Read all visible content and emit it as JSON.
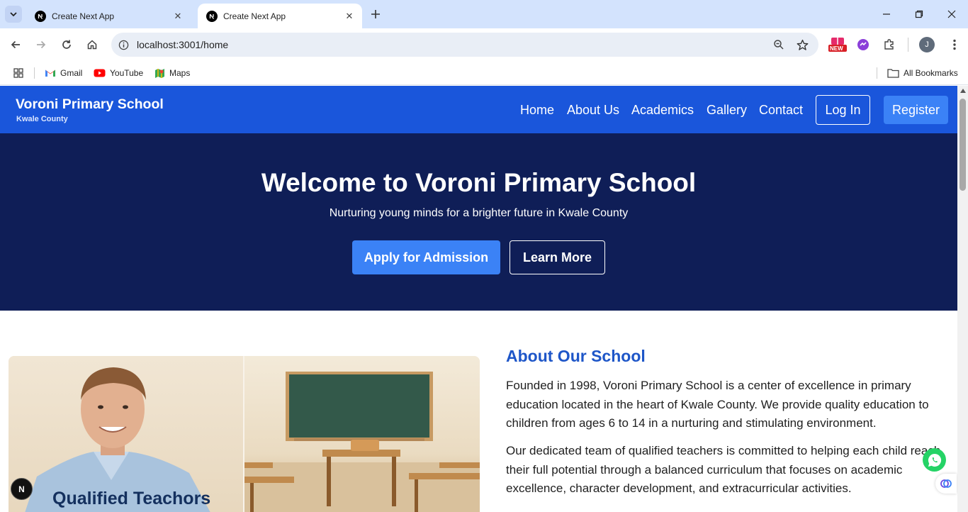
{
  "browser": {
    "tabs": [
      {
        "title": "Create Next App",
        "active": false
      },
      {
        "title": "Create Next App",
        "active": true
      }
    ],
    "url": "localhost:3001/home",
    "ext_badge": "NEW",
    "profile_initial": "J",
    "bookmarks": [
      "Gmail",
      "YouTube",
      "Maps"
    ],
    "all_bookmarks": "All Bookmarks"
  },
  "site": {
    "brand_title": "Voroni Primary School",
    "brand_subtitle": "Kwale County",
    "nav": [
      "Home",
      "About Us",
      "Academics",
      "Gallery",
      "Contact"
    ],
    "login_label": "Log In",
    "register_label": "Register",
    "primary_color": "#1a56db",
    "hero_color": "#0f1e57"
  },
  "hero": {
    "title": "Welcome to Voroni Primary School",
    "subtitle": "Nurturing young minds for a brighter future in Kwale County",
    "apply_label": "Apply for Admission",
    "learn_label": "Learn More"
  },
  "about": {
    "image_caption": "Qualified Teachors",
    "title": "About Our School",
    "paragraphs": [
      "Founded in 1998, Voroni Primary School is a center of excellence in primary education located in the heart of Kwale County. We provide quality education to children from ages 6 to 14 in a nurturing and stimulating environment.",
      "Our dedicated team of qualified teachers is committed to helping each child reach their full potential through a balanced curriculum that focuses on academic excellence, character development, and extracurricular activities."
    ]
  },
  "dev": {
    "next_badge": "N"
  }
}
